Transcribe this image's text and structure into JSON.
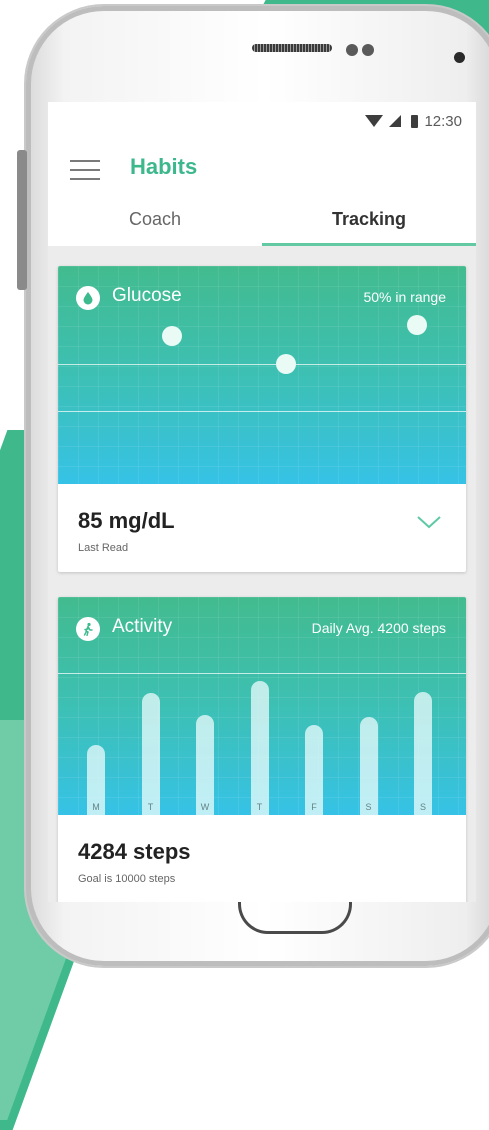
{
  "status": {
    "time": "12:30"
  },
  "appbar": {
    "title": "Habits"
  },
  "tabs": [
    {
      "label": "Coach"
    },
    {
      "label": "Tracking"
    }
  ],
  "glucose": {
    "title": "Glucose",
    "range_text": "50% in range",
    "value": "85 mg/dL",
    "sub": "Last Read",
    "readings": [
      0.32,
      0.62,
      0.93
    ],
    "reading_levels": [
      0.68,
      0.55,
      0.73
    ]
  },
  "activity": {
    "title": "Activity",
    "avg_text": "Daily Avg. 4200 steps",
    "value": "4284 steps",
    "sub": "Goal is 10000 steps",
    "days": [
      "M",
      "T",
      "W",
      "T",
      "F",
      "S",
      "S"
    ],
    "levels": [
      0.52,
      0.91,
      0.75,
      1.0,
      0.67,
      0.73,
      0.92
    ]
  },
  "colors": {
    "accent": "#3db88c",
    "gradient_top": "#42bb8e",
    "gradient_bottom": "#36c2e6"
  }
}
